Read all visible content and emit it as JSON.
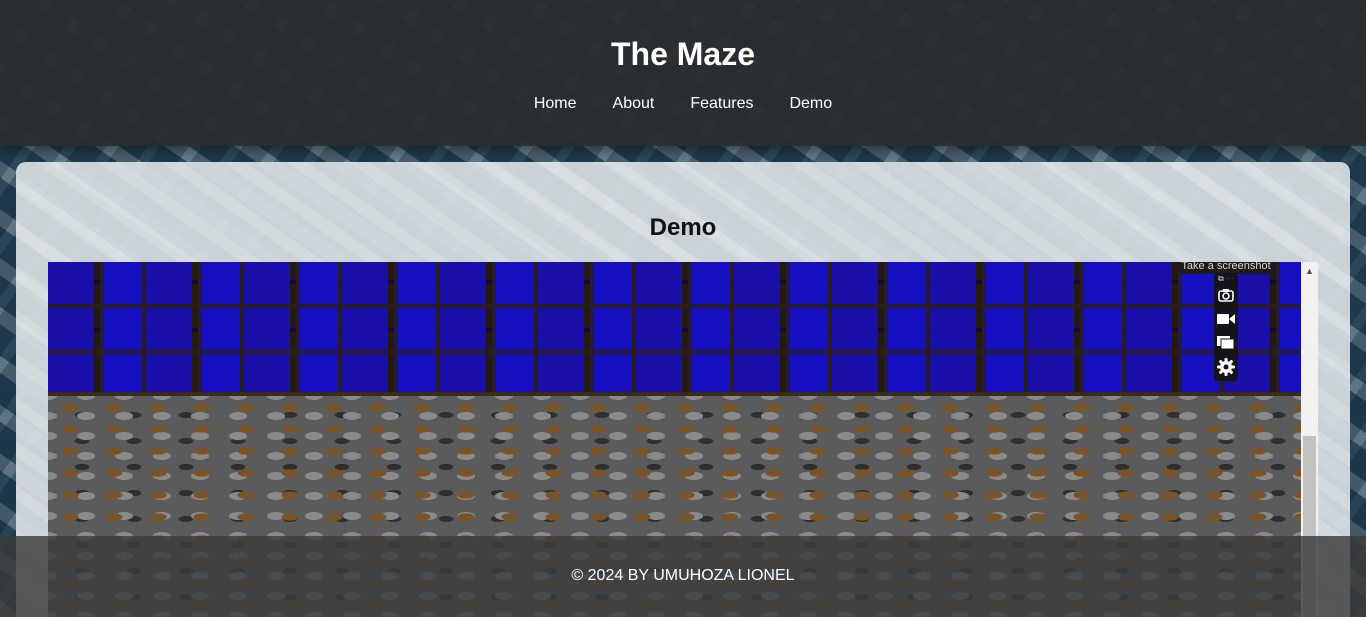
{
  "header": {
    "title": "The Maze",
    "nav": [
      "Home",
      "About",
      "Features",
      "Demo"
    ]
  },
  "main": {
    "section_title": "Demo"
  },
  "screenshot_tool": {
    "tooltip": "Take a screenshot",
    "buttons": [
      "camera-icon",
      "video-icon",
      "copy-window-icon",
      "gear-icon"
    ]
  },
  "footer": {
    "text": "© 2024 BY UMUHOZA LIONEL"
  },
  "colors": {
    "header_bg": "#282c2f",
    "card_bg": "#e1e6e9",
    "wall_blue": "#1a0fa8",
    "footer_bg": "#3c3c3c"
  }
}
